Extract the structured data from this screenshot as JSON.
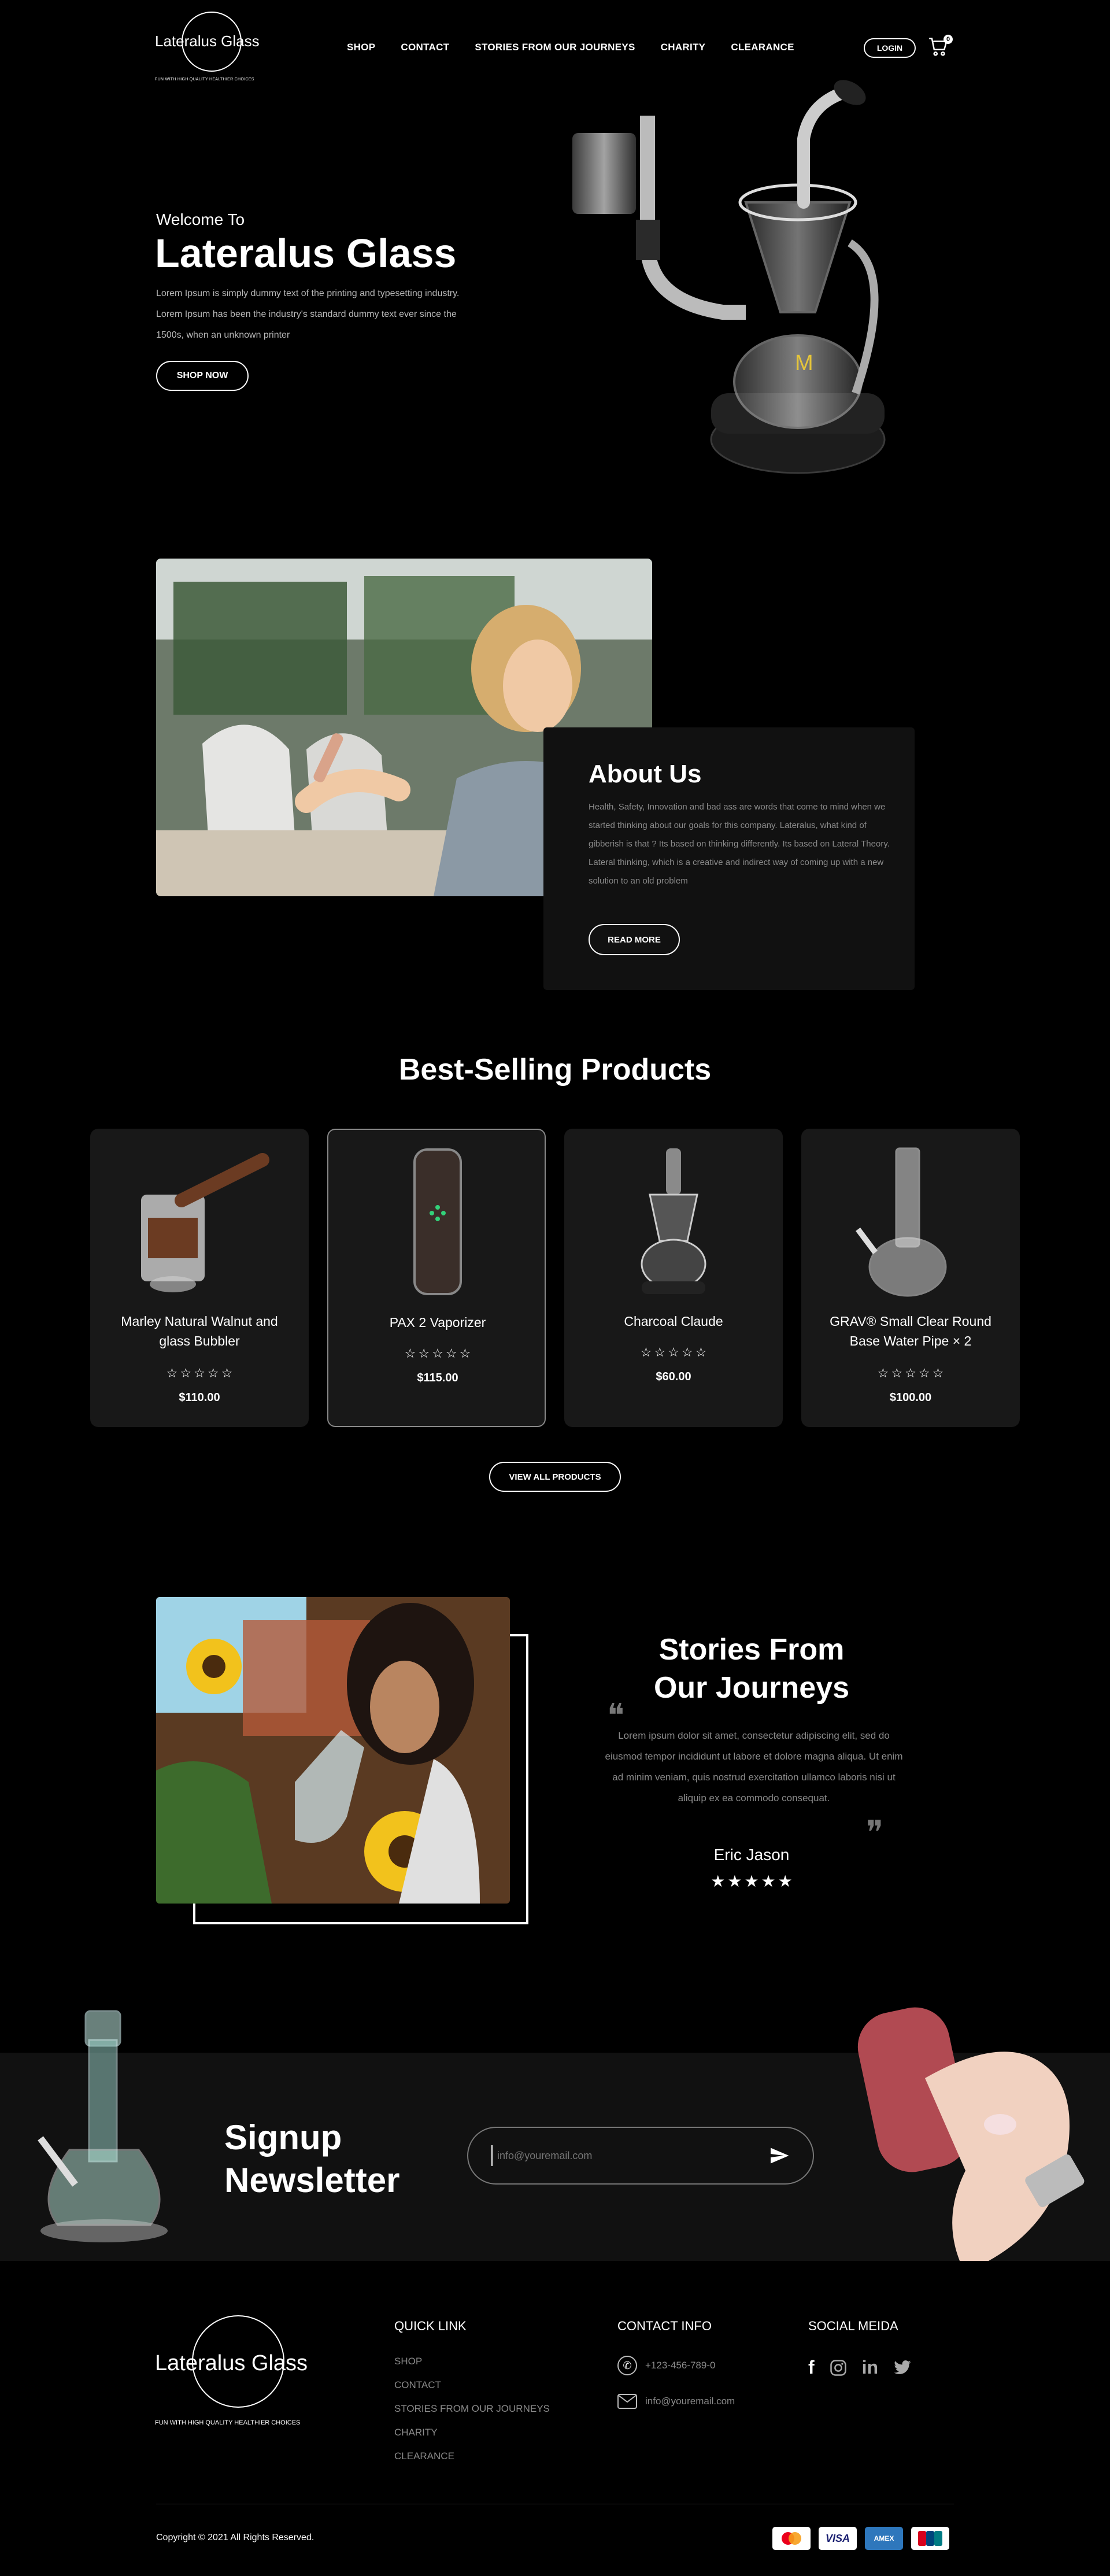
{
  "header": {
    "logo_text": "Lateralus Glass",
    "logo_tagline": "FUN WITH HIGH QUALITY HEALTHIER CHOICES",
    "nav": [
      "SHOP",
      "CONTACT",
      "STORIES FROM OUR JOURNEYS",
      "CHARITY",
      "CLEARANCE"
    ],
    "login_label": "LOGIN",
    "cart_count": "0"
  },
  "hero": {
    "welcome": "Welcome To",
    "title": "Lateralus Glass",
    "text": "Lorem Ipsum is simply dummy text of the printing and typesetting industry. Lorem Ipsum has been the industry's standard dummy text ever since the 1500s, when an unknown printer",
    "cta": "SHOP NOW"
  },
  "about": {
    "title": "About Us",
    "text": "Health, Safety, Innovation and bad ass are words that come to mind when we started thinking about our goals for this company. Lateralus, what kind of gibberish is that ? Its based on thinking differently. Its based on Lateral Theory. Lateral thinking, which is a creative and indirect way of coming up with a new solution to an old problem",
    "cta": "READ MORE"
  },
  "products": {
    "title": "Best-Selling Products",
    "items": [
      {
        "name": "Marley Natural Walnut and glass Bubbler",
        "price": "$110.00",
        "rating": 0
      },
      {
        "name": "PAX 2 Vaporizer",
        "price": "$115.00",
        "rating": 0
      },
      {
        "name": "Charcoal Claude",
        "price": "$60.00",
        "rating": 0
      },
      {
        "name": "GRAV® Small Clear Round Base Water Pipe × 2",
        "price": "$100.00",
        "rating": 0
      }
    ],
    "view_all": "VIEW ALL PRODUCTS"
  },
  "stories": {
    "title_line1": "Stories From",
    "title_line2": "Our Journeys",
    "quote": "Lorem ipsum dolor sit amet, consectetur adipiscing elit, sed do eiusmod tempor incididunt ut labore et dolore magna aliqua. Ut enim ad minim veniam, quis nostrud exercitation ullamco laboris nisi ut aliquip ex ea commodo consequat.",
    "author": "Eric Jason",
    "rating": 5
  },
  "newsletter": {
    "title_line1": "Signup",
    "title_line2": "Newsletter",
    "placeholder": "info@youremail.com"
  },
  "footer": {
    "logo_text": "Lateralus Glass",
    "logo_tagline": "FUN WITH HIGH QUALITY HEALTHIER CHOICES",
    "quick_link_title": "QUICK LINK",
    "quick_links": [
      "SHOP",
      "CONTACT",
      "STORIES FROM OUR JOURNEYS",
      "CHARITY",
      "CLEARANCE"
    ],
    "contact_title": "CONTACT INFO",
    "phone": "+123-456-789-0",
    "email": "info@youremail.com",
    "social_title": "SOCIAL MEIDA",
    "social_icons": [
      "facebook-icon",
      "instagram-icon",
      "linkedin-icon",
      "twitter-icon"
    ],
    "copyright": "Copyright © 2021 All Rights Reserved.",
    "payments": [
      {
        "name": "mastercard-icon",
        "label": "●●",
        "bg": "#ffffff",
        "fg": "#eb001b"
      },
      {
        "name": "visa-icon",
        "label": "VISA",
        "bg": "#ffffff",
        "fg": "#1a1f71"
      },
      {
        "name": "amex-icon",
        "label": "AMEX",
        "bg": "#2e77bc",
        "fg": "#ffffff"
      },
      {
        "name": "unionpay-icon",
        "label": "UP",
        "bg": "#ffffff",
        "fg": "#d7001d"
      }
    ]
  },
  "colors": {
    "background": "#000000",
    "card": "#181818",
    "panel": "#111111",
    "muted": "#8a8a8a",
    "star_filled": "#ffffff"
  }
}
